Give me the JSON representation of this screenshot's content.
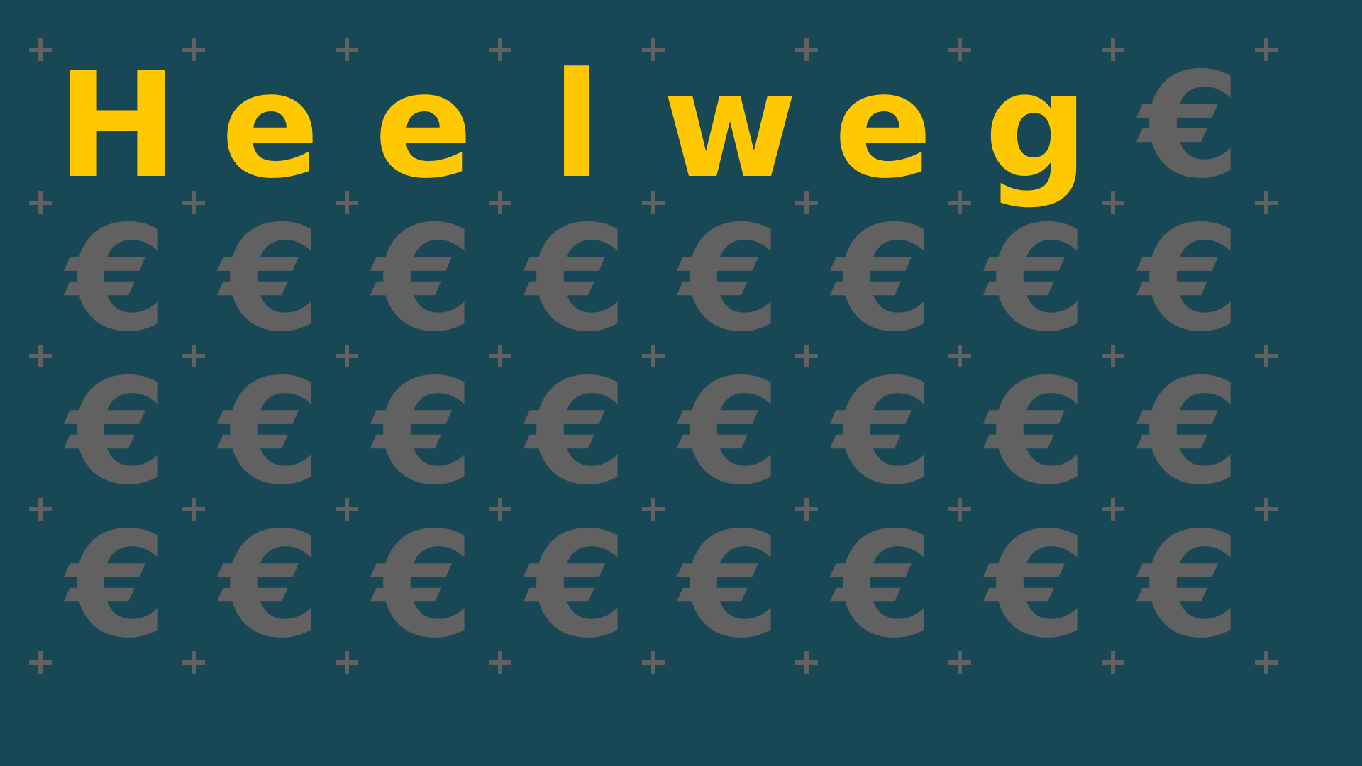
{
  "title_letters": [
    "H",
    "e",
    "e",
    "l",
    " ",
    "w",
    "e",
    "g"
  ],
  "euro_symbol": "€",
  "euro_cell_count": 25,
  "grid": {
    "columns": 8,
    "rows": 4
  },
  "colors": {
    "background": "#184755",
    "letters": "#ffc800",
    "euro": "#616161",
    "plus": "#616161"
  }
}
